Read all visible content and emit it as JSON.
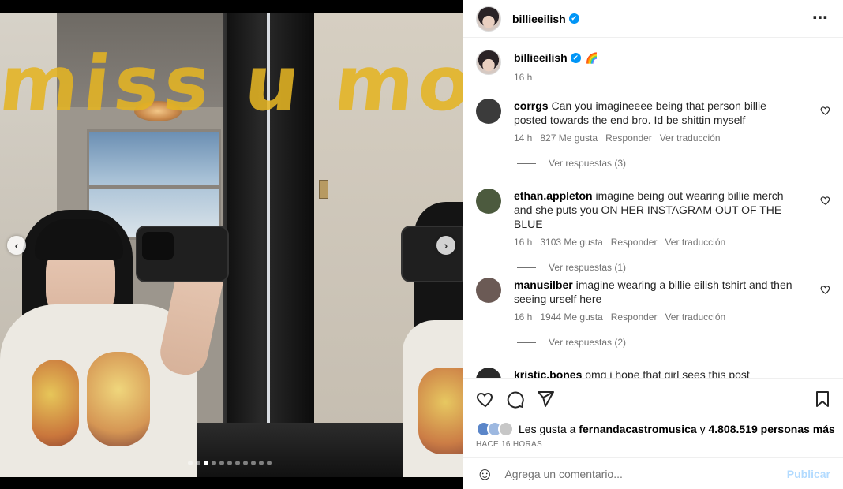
{
  "post": {
    "username": "billieeilish",
    "verified_mark": "✔",
    "more_icon": "⋯",
    "caption": {
      "username": "billieeilish",
      "emoji": "🌈",
      "time": "16 h"
    },
    "photo_text": "miss u mon",
    "carousel": {
      "prev_icon": "‹",
      "next_icon": "›",
      "dots": 11,
      "active_dot": 2
    }
  },
  "comments": [
    {
      "username": "corrgs",
      "text": "Can you imagineeee being that person billie posted towards the end bro. Id be shittin myself",
      "time": "14 h",
      "likes": "827 Me gusta",
      "reply": "Responder",
      "translate": "Ver traducción",
      "replies": "Ver respuestas (3)",
      "avatar_color": "#3b3b3b"
    },
    {
      "username": "ethan.appleton",
      "text": "imagine being out wearing billie merch and she puts you ON HER INSTAGRAM OUT OF THE BLUE",
      "time": "16 h",
      "likes": "3103 Me gusta",
      "reply": "Responder",
      "translate": "Ver traducción",
      "replies": "Ver respuestas (1)",
      "avatar_color": "#4c5a3e"
    },
    {
      "username": "manusilber",
      "text": "imagine wearing a billie eilish tshirt and then seeing urself here",
      "time": "16 h",
      "likes": "1944 Me gusta",
      "reply": "Responder",
      "translate": "Ver traducción",
      "replies": "Ver respuestas (2)",
      "avatar_color": "#6b5a55"
    },
    {
      "username": "kristic.bones",
      "text": "omg i hope that girl sees this post",
      "avatar_color": "#2a2a2a"
    }
  ],
  "actions": {
    "like_icon": "heart-icon",
    "comment_icon": "comment-icon",
    "share_icon": "send-icon",
    "save_icon": "bookmark-icon"
  },
  "likes": {
    "prefix": "Les gusta a",
    "user": "fernandacastromusica",
    "middle": "y",
    "count": "4.808.519 personas más"
  },
  "timestamp": "HACE 16 HORAS",
  "composer": {
    "placeholder": "Agrega un comentario...",
    "publish": "Publicar",
    "emoji_icon": "☺"
  }
}
